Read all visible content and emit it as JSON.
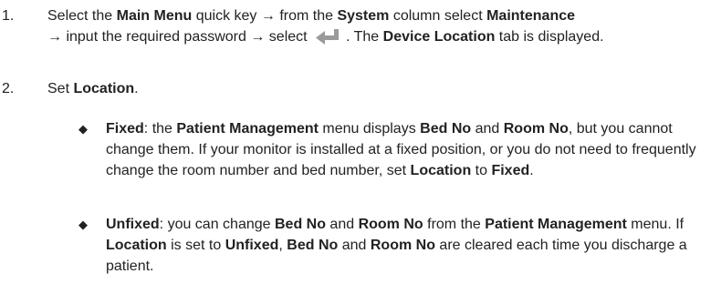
{
  "step1": {
    "number": "1.",
    "parts": [
      "Select the ",
      "Main Menu",
      " quick key → from the ",
      "System",
      " column select ",
      "Maintenance",
      "→ input the required password → select ",
      ". The ",
      "Device Location",
      " tab is displayed."
    ],
    "enter_icon": "enter-return-icon"
  },
  "step2": {
    "number": "2.",
    "parts": [
      "Set ",
      "Location",
      "."
    ]
  },
  "bullets": [
    {
      "symbol": "◆",
      "parts": [
        "Fixed",
        ": the ",
        "Patient Management",
        " menu displays ",
        "Bed No",
        " and ",
        "Room No",
        ", but you cannot change them. If your monitor is installed at a fixed position, or you do not need to frequently change the room number and bed number, set ",
        "Location",
        " to ",
        "Fixed",
        "."
      ]
    },
    {
      "symbol": "◆",
      "parts": [
        "Unfixed",
        ": you can change ",
        "Bed No",
        " and ",
        "Room No",
        " from the ",
        "Patient Management",
        " menu. If ",
        "Location",
        " is set to ",
        "Unfixed",
        ", ",
        "Bed No",
        " and ",
        "Room No",
        " are cleared each time you discharge a patient."
      ]
    }
  ],
  "colors": {
    "text": "#222222",
    "icon_gray": "#9a9a9a"
  }
}
